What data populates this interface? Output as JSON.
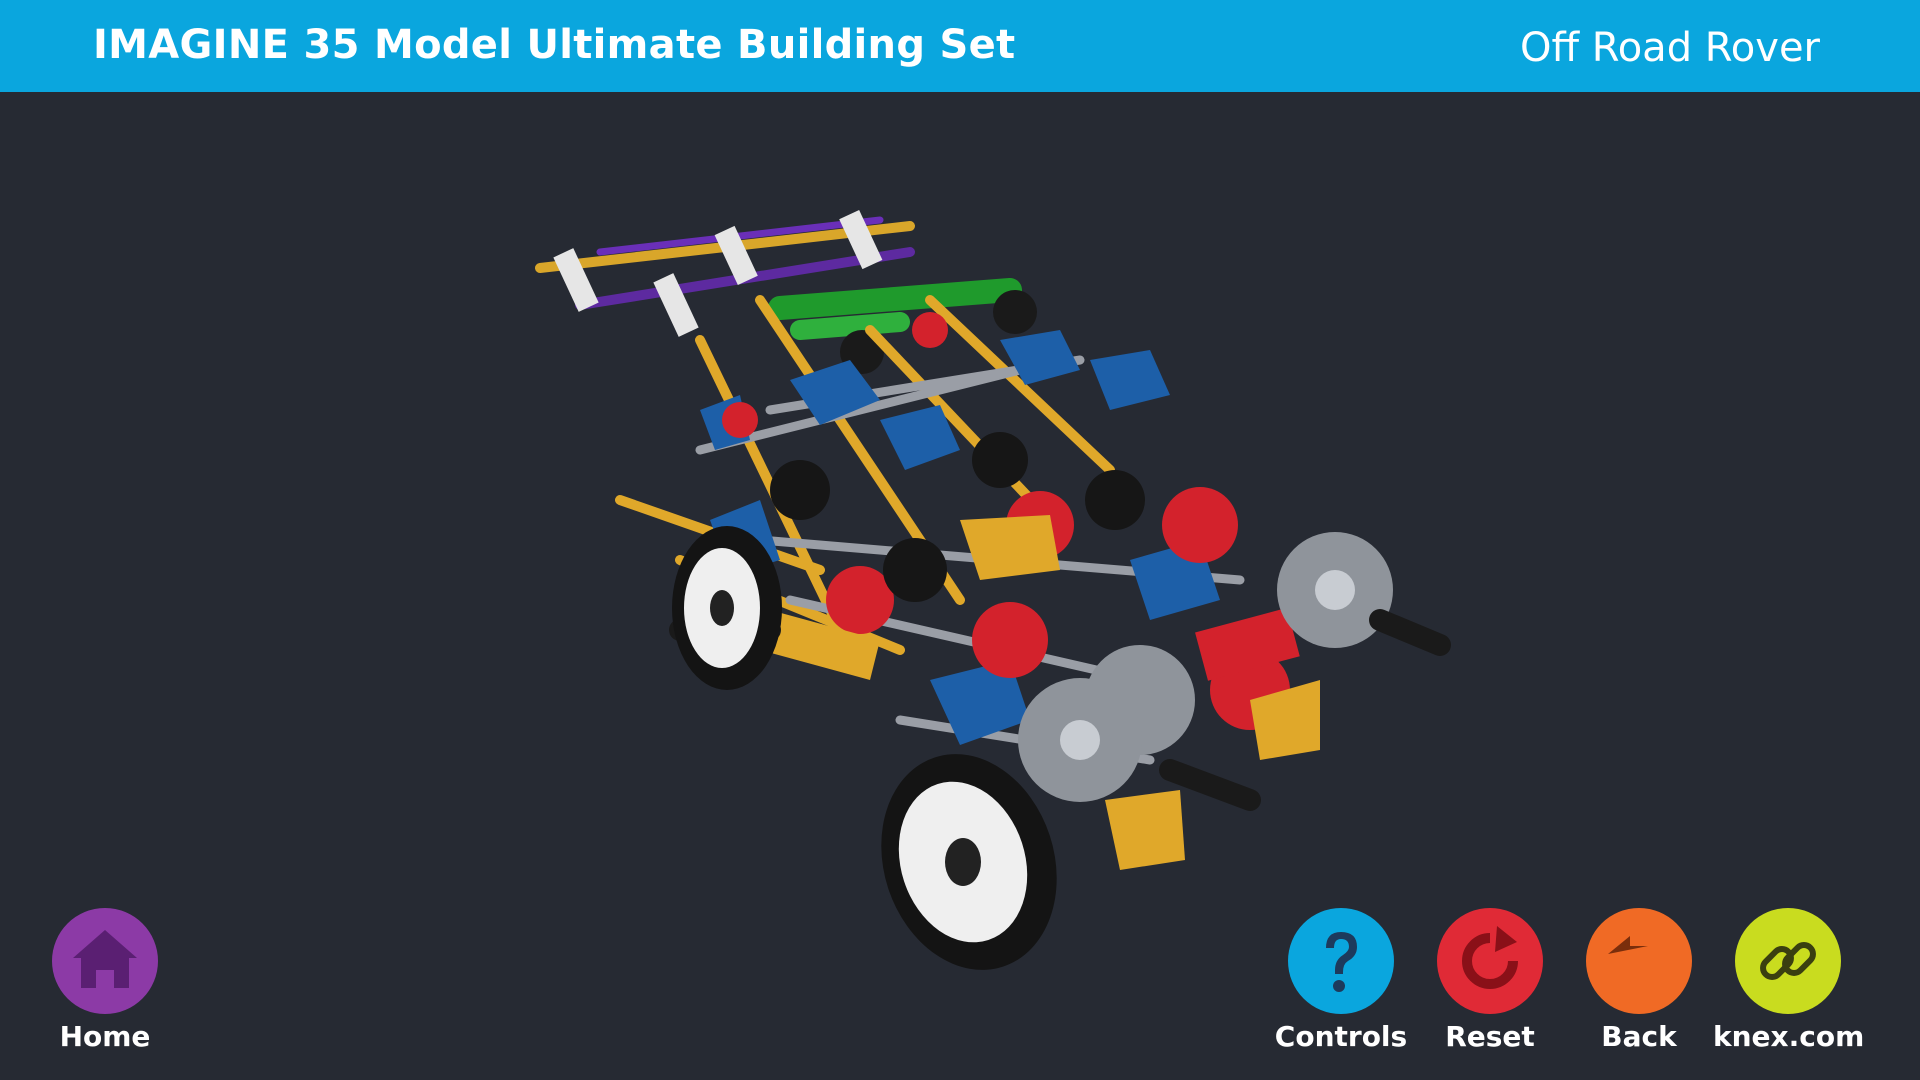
{
  "header": {
    "set_title": "IMAGINE 35 Model Ultimate Building Set",
    "model_name": "Off Road Rover"
  },
  "buttons": {
    "home": {
      "label": "Home",
      "color": "#8c3aa6",
      "icon": "home-icon"
    },
    "controls": {
      "label": "Controls",
      "color": "#0aa6de",
      "icon": "question-icon"
    },
    "reset": {
      "label": "Reset",
      "color": "#e02a36",
      "icon": "reset-icon"
    },
    "back": {
      "label": "Back",
      "color": "#f06a25",
      "icon": "back-arrow-icon"
    },
    "knex": {
      "label": "knex.com",
      "color": "#c9dc1f",
      "icon": "link-icon"
    }
  },
  "colors": {
    "header_bg": "#0aa6de",
    "viewport_bg": "#262a33"
  }
}
